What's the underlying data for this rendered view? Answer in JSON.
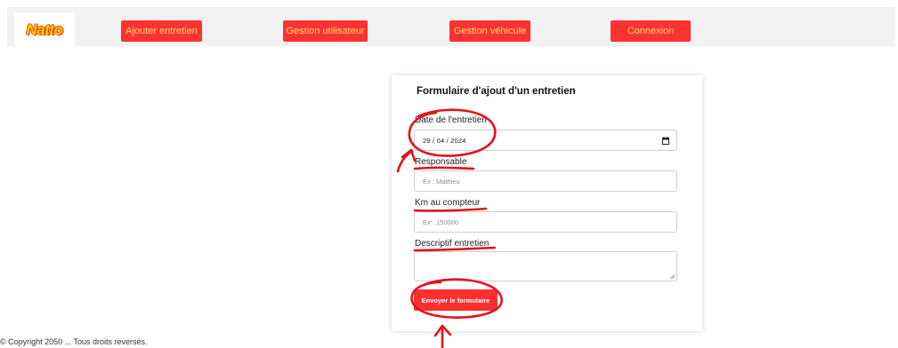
{
  "navbar": {
    "logo_text": "Natto",
    "items": [
      {
        "label": "Ajouter entretien"
      },
      {
        "label": "Gestion utilisateur"
      },
      {
        "label": "Gestion véhicule"
      },
      {
        "label": "Connexion"
      }
    ]
  },
  "form": {
    "title": "Formulaire d'ajout d'un entretien",
    "fields": [
      {
        "label": "Date de l'entretien",
        "value": "29 / 04 / 2024",
        "type": "date"
      },
      {
        "label": "Responsable",
        "placeholder": "Ex : Mathieu"
      },
      {
        "label": "Km au compteur",
        "placeholder": "Ex : 150000"
      },
      {
        "label": "Descriptif entretien",
        "placeholder": ""
      }
    ],
    "submit_label": "Envoyer le formulaire"
  },
  "footer": {
    "text": "© Copyright 2050 ... Tous droits reversés."
  },
  "colors": {
    "nav_background": "#f2f2f2",
    "nav_button": "#ff3131",
    "nav_button_text": "#ffe16a",
    "submit_button": "#ff2e2e",
    "annotation_ink": "#e0141e"
  }
}
